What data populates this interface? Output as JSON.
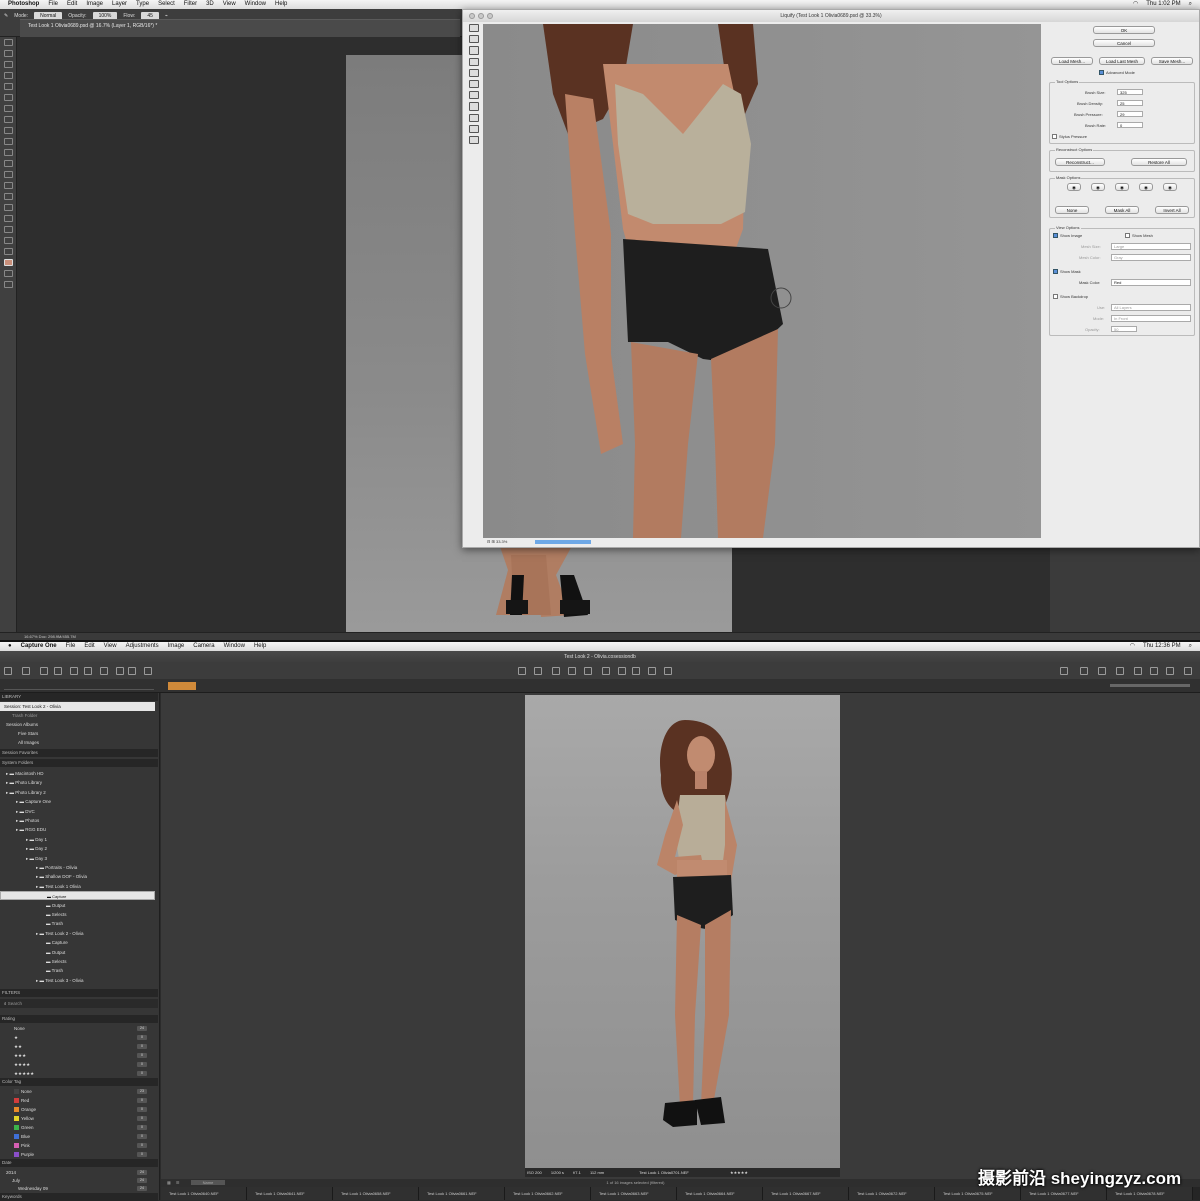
{
  "ps_menubar": {
    "app": "Photoshop",
    "items": [
      "File",
      "Edit",
      "Image",
      "Layer",
      "Type",
      "Select",
      "Filter",
      "3D",
      "View",
      "Window",
      "Help"
    ],
    "clock": "Thu 1:02 PM"
  },
  "ps_options": {
    "mode_label": "Mode:",
    "mode_value": "Normal",
    "opacity_label": "Opacity:",
    "opacity_value": "100%",
    "flow_label": "Flow:",
    "flow_value": "45"
  },
  "ps_doc_tab": "Test Look 1 Olivia0689.psd @ 16.7% (Layer 1, RGB/16*) *",
  "ps_status": "16.67%   Doc: 298.9M/455.7M",
  "liquify": {
    "title": "Liquify (Test Look 1 Olivia0689.psd @ 33.3%)",
    "ok": "OK",
    "cancel": "Cancel",
    "load_mesh": "Load Mesh...",
    "load_last_mesh": "Load Last Mesh",
    "save_mesh": "Save Mesh...",
    "advanced_mode": "Advanced Mode",
    "tool_options": "Tool Options",
    "brush_size_label": "Brush Size:",
    "brush_size": "325",
    "brush_density_label": "Brush Density:",
    "brush_density": "25",
    "brush_pressure_label": "Brush Pressure:",
    "brush_pressure": "29",
    "brush_rate_label": "Brush Rate:",
    "brush_rate": "0",
    "stylus_pressure": "Stylus Pressure",
    "reconstruct_options": "Reconstruct Options",
    "reconstruct": "Reconstruct...",
    "restore_all": "Restore All",
    "mask_options": "Mask Options",
    "none": "None",
    "mask_all": "Mask All",
    "invert_all": "Invert All",
    "view_options": "View Options",
    "show_image": "Show Image",
    "show_mesh": "Show Mesh",
    "mesh_size_label": "Mesh Size:",
    "mesh_size": "Large",
    "mesh_color_label": "Mesh Color:",
    "mesh_color": "Gray",
    "show_mask": "Show Mask",
    "mask_color_label": "Mask Color:",
    "mask_color": "Red",
    "show_backdrop": "Show Backdrop",
    "use_label": "Use:",
    "use_value": "All Layers",
    "mode_label": "Mode:",
    "mode_value": "In Front",
    "opacity_label": "Opacity:",
    "opacity_value": "50",
    "zoom": "33.3%"
  },
  "co_menubar": {
    "app": "Capture One",
    "items": [
      "File",
      "Edit",
      "View",
      "Adjustments",
      "Image",
      "Camera",
      "Window",
      "Help"
    ],
    "clock": "Thu 12:36 PM"
  },
  "co_title": "Test Look 2 - Olivia.cosessiondb",
  "co_library": {
    "header": "LIBRARY",
    "session": "Session: Test Look 2 - Olivia",
    "trash_folder": "Trash Folder",
    "session_albums": "Session Albums",
    "five_stars": "Five Stars",
    "all_images": "All Images",
    "session_favorites": "Session Favorites",
    "system_folders": "System Folders",
    "folders": [
      {
        "label": "Macintosh HD",
        "level": 0
      },
      {
        "label": "Photo Library",
        "level": 0
      },
      {
        "label": "Photo Library 2",
        "level": 0
      },
      {
        "label": "Capture One",
        "level": 1
      },
      {
        "label": "DVC",
        "level": 1
      },
      {
        "label": "Photos",
        "level": 1
      },
      {
        "label": "RGG EDU",
        "level": 1
      },
      {
        "label": "Day 1",
        "level": 2
      },
      {
        "label": "Day 2",
        "level": 2
      },
      {
        "label": "Day 3",
        "level": 2
      },
      {
        "label": "Portraits - Olivia",
        "level": 3
      },
      {
        "label": "Shallow DOF - Olivia",
        "level": 3
      },
      {
        "label": "Test Look 1 Olivia",
        "level": 3
      },
      {
        "label": "Capture",
        "level": 4
      },
      {
        "label": "Output",
        "level": 4
      },
      {
        "label": "Selects",
        "level": 4
      },
      {
        "label": "Trash",
        "level": 4
      },
      {
        "label": "Test Look 2 - Olivia",
        "level": 3
      },
      {
        "label": "Capture",
        "level": 4
      },
      {
        "label": "Output",
        "level": 4
      },
      {
        "label": "Selects",
        "level": 4
      },
      {
        "label": "Trash",
        "level": 4
      },
      {
        "label": "Test Look 3 - Olivia",
        "level": 3
      }
    ],
    "filters_header": "FILTERS",
    "search_placeholder": "Search",
    "rating_header": "Rating",
    "ratings": [
      {
        "label": "None",
        "count": "24"
      },
      {
        "label": "★",
        "count": "0"
      },
      {
        "label": "★★",
        "count": "0"
      },
      {
        "label": "★★★",
        "count": "0"
      },
      {
        "label": "★★★★",
        "count": "0"
      },
      {
        "label": "★★★★★",
        "count": "0"
      }
    ],
    "color_tag_header": "Color Tag",
    "color_tags": [
      {
        "label": "None",
        "count": "23",
        "color": "#444444"
      },
      {
        "label": "Red",
        "count": "0",
        "color": "#d23c3c"
      },
      {
        "label": "Orange",
        "count": "0",
        "color": "#e88a2a"
      },
      {
        "label": "Yellow",
        "count": "0",
        "color": "#e3d32a"
      },
      {
        "label": "Green",
        "count": "0",
        "color": "#3cb44b"
      },
      {
        "label": "Blue",
        "count": "0",
        "color": "#3f6fd6"
      },
      {
        "label": "Pink",
        "count": "0",
        "color": "#d65fb3"
      },
      {
        "label": "Purple",
        "count": "0",
        "color": "#8a4fc9"
      }
    ],
    "date_header": "Date",
    "dates": [
      {
        "label": "2014",
        "count": "24"
      },
      {
        "label": "July",
        "count": "24"
      },
      {
        "label": "Wednesday 09",
        "count": "24"
      }
    ],
    "keywords_header": "Keywords"
  },
  "co_image_info": {
    "iso": "ISO 200",
    "shutter": "1/200 s",
    "aperture": "f/7.1",
    "focal": "112 mm",
    "filename": "Test Look 1 Olivia0701.NEF"
  },
  "co_filmstrip": {
    "sort_label": "Name",
    "status": "1 of 16 images selected (filtered)",
    "files": [
      "Test Look 1 Olivia0640.NEF",
      "Test Look 1 Olivia0641.NEF",
      "Test Look 1 Olivia0658.NEF",
      "Test Look 1 Olivia0661.NEF",
      "Test Look 1 Olivia0662.NEF",
      "Test Look 1 Olivia0663.NEF",
      "Test Look 1 Olivia0664.NEF",
      "Test Look 1 Olivia0667.NEF",
      "Test Look 1 Olivia0672.NEF",
      "Test Look 1 Olivia0675.NEF",
      "Test Look 1 Olivia0677.NEF",
      "Test Look 1 Olivia0678.NEF"
    ]
  },
  "watermark": "摄影前沿 sheyingzyz.com",
  "colors": {
    "ps_bg": "#2e2e2e",
    "co_bg": "#3a3a3a",
    "selected_row": "#e6e6e6",
    "accent": "#6ea8e6"
  }
}
